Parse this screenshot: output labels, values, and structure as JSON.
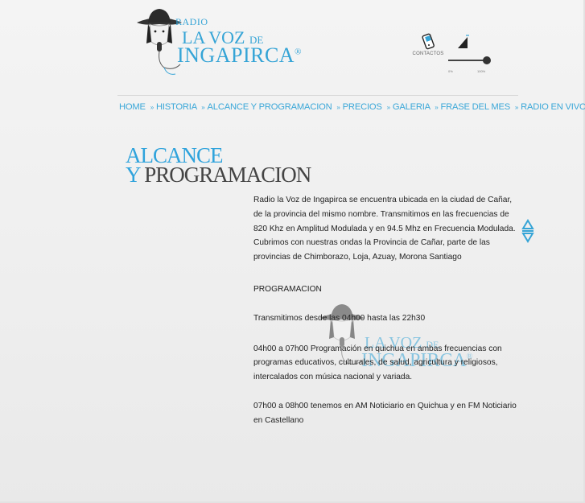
{
  "logo": {
    "radio": "RADIO",
    "la_voz": "LA VOZ",
    "de": "DE",
    "ingapirca": "INGAPIRCA",
    "registered": "®"
  },
  "header": {
    "contact_label": "CONTACTOS",
    "volume_min": "0%",
    "volume_max": "100%",
    "volume_level": 1.0
  },
  "nav": {
    "items": [
      "HOME",
      "HISTORIA",
      "ALCANCE Y PROGRAMACION",
      "PRECIOS",
      "GALERIA",
      "FRASE DEL MES",
      "RADIO EN VIVO"
    ],
    "separator": "»"
  },
  "page": {
    "title_line1": "ALCANCE",
    "title_y": "Y",
    "title_line2": "PROGRAMACION",
    "intro": "Radio la Voz de Ingapirca se encuentra ubicada en la ciudad de Cañar, de la provincia del mismo nombre. Transmitimos en las frecuencias de 820 Khz en Amplitud Modulada y en 94.5 Mhz en Frecuencia Modulada. Cubrimos con nuestras ondas la Provincia de Cañar, parte de las provincias de Chimborazo, Loja, Azuay, Morona Santiago",
    "section_heading": "PROGRAMACION",
    "schedule": "Transmitimos desde las 04h00 hasta las 22h30",
    "block1": "04h00  a  07h00 Programación en quichua en ambas frecuencias con programas educativos, culturales, de salud, agricultura y religiosos, intercalados con música nacional y variada.",
    "block2": "07h00  a  08h00 tenemos en AM  Noticiario en Quichua y en FM Noticiario en Castellano"
  },
  "colors": {
    "accent": "#35a4d6",
    "text": "#222222",
    "background": "#efefef"
  },
  "icons": {
    "contact": "phone-icon",
    "volume": "speaker-icon",
    "scroll": "up-down-arrows-icon"
  }
}
